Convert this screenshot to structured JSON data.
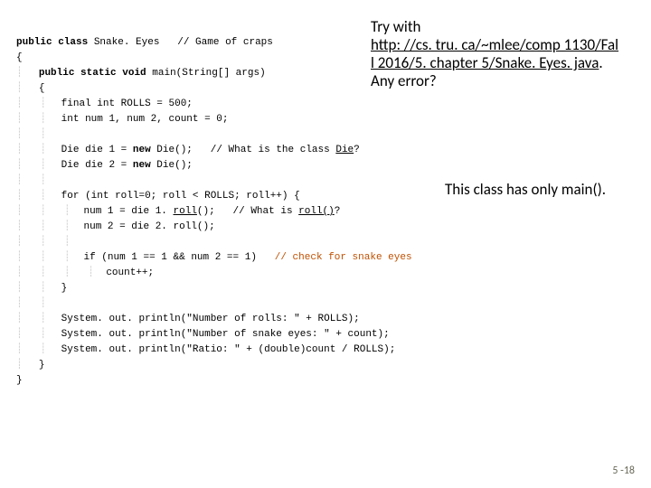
{
  "code": {
    "l1a": "public class ",
    "l1b": "Snake. Eyes",
    "l1c": "   // Game of craps",
    "l2": "{",
    "l3a": "    public static void ",
    "l3b": "main(String[] args)",
    "l4": "    {",
    "l5a": "        final int ROLLS = 500;",
    "l6": "        int num 1, num 2, count = 0;",
    "l7": "",
    "l8a": "        Die die 1 = ",
    "l8b": "new",
    "l8c": " Die();   // What is the class ",
    "l8d": "Die",
    "l8e": "?",
    "l9a": "        Die die 2 = ",
    "l9b": "new",
    "l9c": " Die();",
    "l10": "",
    "l11": "        for (int roll=0; roll < ROLLS; roll++) {",
    "l12a": "            num 1 = die 1. ",
    "l12b": "roll",
    "l12c": "();   // What is ",
    "l12d": "roll()",
    "l12e": "?",
    "l13": "            num 2 = die 2. roll();",
    "l14": "",
    "l15a": "            if (num 1 == 1 && num 2 == 1)   ",
    "l15b": "// check for snake eyes",
    "l16": "                count++;",
    "l17": "        }",
    "l18": "",
    "l19": "        System. out. println(\"Number of rolls: \" + ROLLS);",
    "l20": "        System. out. println(\"Number of snake eyes: \" + count);",
    "l21": "        System. out. println(\"Ratio: \" + (double)count / ROLLS);",
    "l22": "    }",
    "l23": "}"
  },
  "note1": {
    "line1": "Try with",
    "link1": "http: //cs. tru. ca/~mlee/comp 1130/Fal",
    "link2": "l 2016/5. chapter 5/Snake. Eyes. java",
    "dot": ".",
    "line3": "Any error?"
  },
  "note2": "This class has only main().",
  "slidenum": "5 -18"
}
